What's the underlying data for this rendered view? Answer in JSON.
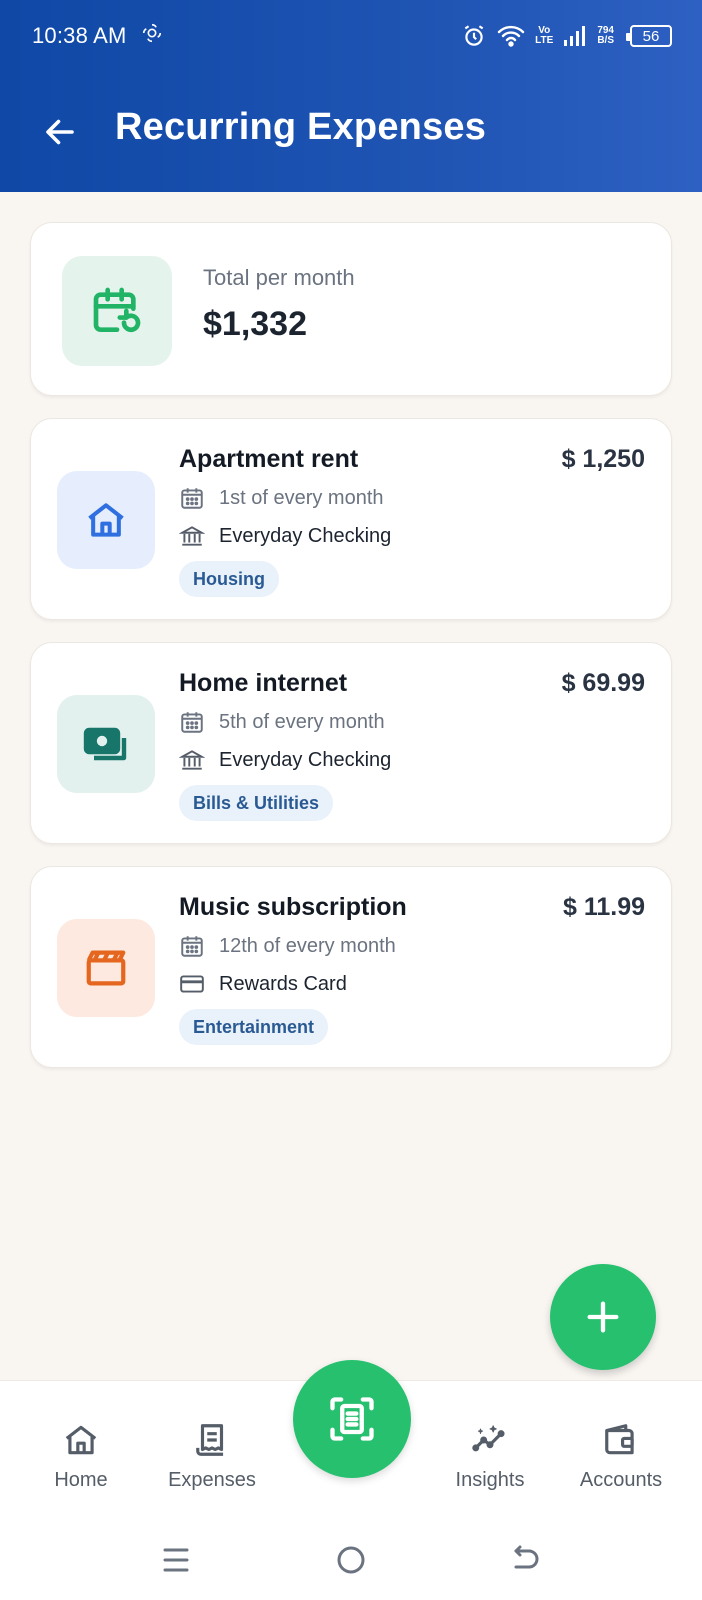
{
  "status_bar": {
    "time": "10:38 AM",
    "network_label": "Vo\nLTE",
    "lte_top": "Vo",
    "lte_bottom": "LTE",
    "speed_top": "794",
    "speed_bottom": "B/S",
    "battery": "56"
  },
  "header": {
    "title": "Recurring Expenses",
    "back_icon": "arrow-left-icon"
  },
  "summary": {
    "label": "Total per month",
    "value": "$1,332",
    "icon": "calendar-repeat-icon"
  },
  "expenses": [
    {
      "name": "Apartment rent",
      "amount": "$ 1,250",
      "schedule": "1st of every month",
      "account": "Everyday Checking",
      "account_icon": "bank-icon",
      "category": "Housing",
      "icon": "home-icon",
      "icon_bg": "#e6edfd",
      "icon_color": "#2f6fe0"
    },
    {
      "name": "Home internet",
      "amount": "$ 69.99",
      "schedule": "5th of every month",
      "account": "Everyday Checking",
      "account_icon": "bank-icon",
      "category": "Bills & Utilities",
      "icon": "cash-icon",
      "icon_bg": "#e2f0ee",
      "icon_color": "#17756a"
    },
    {
      "name": "Music subscription",
      "amount": "$ 11.99",
      "schedule": "12th of every month",
      "account": "Rewards Card",
      "account_icon": "credit-card-icon",
      "category": "Entertainment",
      "icon": "clapperboard-icon",
      "icon_bg": "#fde9df",
      "icon_color": "#e5661f"
    }
  ],
  "fab": {
    "icon": "plus-icon"
  },
  "bottom_nav": {
    "items": [
      {
        "label": "Home",
        "icon": "home-icon"
      },
      {
        "label": "Expenses",
        "icon": "receipt-icon"
      },
      {
        "label": "Insights",
        "icon": "insights-icon"
      },
      {
        "label": "Accounts",
        "icon": "wallet-icon"
      }
    ],
    "center_icon": "scan-receipt-icon"
  },
  "system_nav": {
    "icons": [
      "menu-icon",
      "home-circle-icon",
      "back-icon"
    ]
  },
  "colors": {
    "header_blue": "#1f54b3",
    "accent_green": "#26c06e",
    "tag_bg": "#e9f1fb",
    "tag_text": "#2a5a93",
    "background": "#f9f6f2"
  }
}
